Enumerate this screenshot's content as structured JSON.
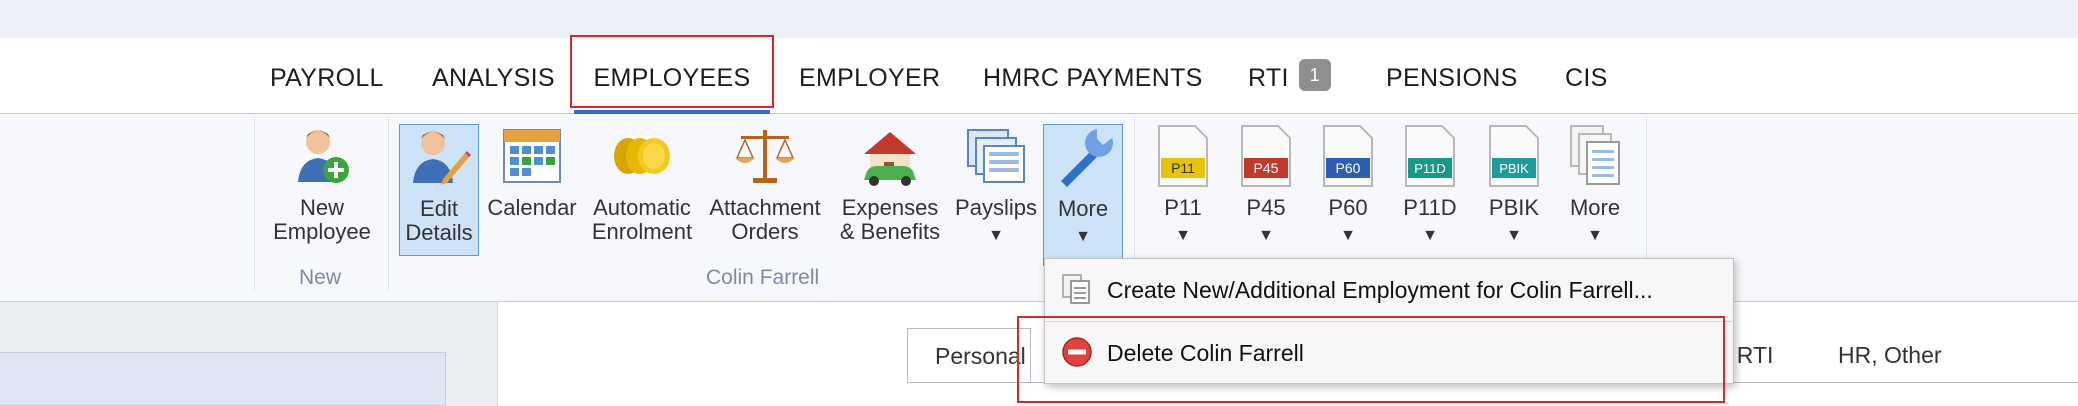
{
  "tabs": [
    {
      "label": "PAYROLL"
    },
    {
      "label": "ANALYSIS"
    },
    {
      "label": "EMPLOYEES"
    },
    {
      "label": "EMPLOYER"
    },
    {
      "label": "HMRC PAYMENTS"
    },
    {
      "label": "RTI",
      "badge": "1"
    },
    {
      "label": "PENSIONS"
    },
    {
      "label": "CIS"
    }
  ],
  "ribbon": {
    "new_employee": {
      "line1": "New",
      "line2": "Employee"
    },
    "group_new": "New",
    "edit_details": {
      "line1": "Edit",
      "line2": "Details"
    },
    "calendar": "Calendar",
    "automatic_enrolment": {
      "line1": "Automatic",
      "line2": "Enrolment"
    },
    "attachment_orders": {
      "line1": "Attachment",
      "line2": "Orders"
    },
    "expenses_benefits": {
      "line1": "Expenses",
      "line2": "& Benefits"
    },
    "payslips": "Payslips",
    "more": "More",
    "group_employee": "Colin Farrell",
    "docs": [
      {
        "label": "P11",
        "tag": "P11",
        "color": "#e8c400"
      },
      {
        "label": "P45",
        "tag": "P45",
        "color": "#c0392b"
      },
      {
        "label": "P60",
        "tag": "P60",
        "color": "#2c5fb3"
      },
      {
        "label": "P11D",
        "tag": "P11D",
        "color": "#17998a"
      },
      {
        "label": "PBIK",
        "tag": "PBIK",
        "color": "#1c9c9c"
      }
    ],
    "more2": "More",
    "arrow": "▼"
  },
  "subtabs": {
    "personal": "Personal",
    "rti_partial": ", RTI",
    "hr_other": "HR, Other"
  },
  "dropdown": {
    "items": [
      {
        "label": "Create New/Additional Employment for Colin Farrell..."
      },
      {
        "label": "Delete Colin Farrell"
      }
    ]
  },
  "colors": {
    "accent": "#2f6fd0",
    "highlight": "#d9272e",
    "selected_bg": "#cde3f8"
  }
}
